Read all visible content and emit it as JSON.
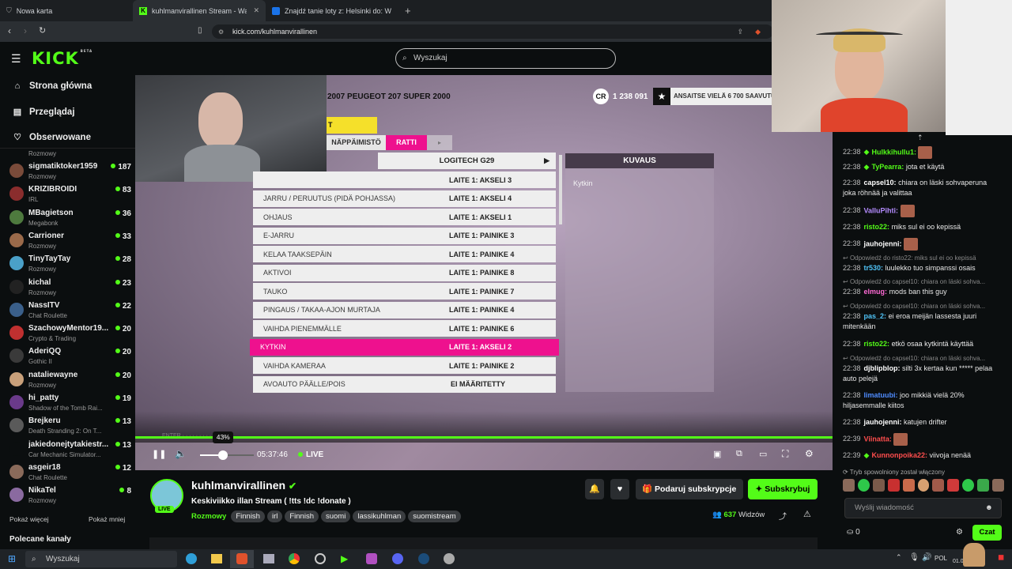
{
  "browser": {
    "tabs": [
      {
        "label": "Nowa karta"
      },
      {
        "label": "kuhlmanvirallinen Stream - Watc"
      },
      {
        "label": "Znajdź tanie loty z: Helsinki do: Wars"
      }
    ],
    "url": "kick.com/kuhlmanvirallinen"
  },
  "site": {
    "logo": "KICK",
    "logo_badge": "BETA",
    "search_placeholder": "Wyszukaj"
  },
  "sidebar": {
    "nav": [
      {
        "label": "Strona główna",
        "icon": "home-icon"
      },
      {
        "label": "Przeglądaj",
        "icon": "browse-icon"
      },
      {
        "label": "Obserwowane",
        "icon": "heart-icon"
      }
    ],
    "first_category_partial": "Rozmowy",
    "channels": [
      {
        "name": "sigmatiktoker1959",
        "category": "Rozmowy",
        "viewers": "187",
        "color": "#7a4b3a"
      },
      {
        "name": "KRIZIBROIDI",
        "category": "IRL",
        "viewers": "83",
        "color": "#8a2d2d"
      },
      {
        "name": "MBagietson",
        "category": "Megabonk",
        "viewers": "36",
        "color": "#4e7a3e"
      },
      {
        "name": "Carrioner",
        "category": "Rozmowy",
        "viewers": "33",
        "color": "#9a6a4a"
      },
      {
        "name": "TinyTayTay",
        "category": "Rozmowy",
        "viewers": "28",
        "color": "#4aa0c8"
      },
      {
        "name": "kichal",
        "category": "Rozmowy",
        "viewers": "23",
        "color": "#222222"
      },
      {
        "name": "NassITV",
        "category": "Chat Roulette",
        "viewers": "22",
        "color": "#3a5f8a"
      },
      {
        "name": "SzachowyMentor19...",
        "category": "Crypto & Trading",
        "viewers": "20",
        "color": "#c03030"
      },
      {
        "name": "AderiQQ",
        "category": "Gothic II",
        "viewers": "20",
        "color": "#3a3a3a"
      },
      {
        "name": "nataliewayne",
        "category": "Rozmowy",
        "viewers": "20",
        "color": "#c8a07a"
      },
      {
        "name": "hi_patty",
        "category": "Shadow of the Tomb Rai...",
        "viewers": "19",
        "color": "#6a3a8a"
      },
      {
        "name": "Brejkeru",
        "category": "Death Stranding 2: On T...",
        "viewers": "13",
        "color": "#5a5a5a"
      },
      {
        "name": "jakiedonejtytakiestr...",
        "category": "Car Mechanic Simulator...",
        "viewers": "13",
        "color": "#0b0e0f"
      },
      {
        "name": "asgeir18",
        "category": "Chat Roulette",
        "viewers": "12",
        "color": "#8a6a5a"
      },
      {
        "name": "NikaTel",
        "category": "Rozmowy",
        "viewers": "8",
        "color": "#8a6aa0"
      }
    ],
    "show_more": "Pokaż więcej",
    "show_less": "Pokaż mniej",
    "recommended": "Polecane kanały"
  },
  "game": {
    "car_title": "2007 PEUGEOT 207 SUPER 2000",
    "credits": "1 238 091",
    "promo": "ANSAITSE VIELÄ 6 700 SAAVUTUS",
    "tab_keyboard": "NÄPPÄIMISTÖ",
    "tab_wheel": "RATTI",
    "device": "LOGITECH G29",
    "desc_header": "KUVAUS",
    "desc_text": "Kytkin",
    "rows": [
      {
        "label": "",
        "value": "LAITE 1: AKSELI 3"
      },
      {
        "label": "JARRU / PERUUTUS (PIDÄ POHJASSA)",
        "value": "LAITE 1: AKSELI 4"
      },
      {
        "label": "OHJAUS",
        "value": "LAITE 1: AKSELI 1"
      },
      {
        "label": "E-JARRU",
        "value": "LAITE 1: PAINIKE 3"
      },
      {
        "label": "KELAA TAAKSEPÄIN",
        "value": "LAITE 1: PAINIKE 4"
      },
      {
        "label": "AKTIVOI",
        "value": "LAITE 1: PAINIKE 8"
      },
      {
        "label": "TAUKO",
        "value": "LAITE 1: PAINIKE 7"
      },
      {
        "label": "PINGAUS / TAKAA-AJON MURTAJA",
        "value": "LAITE 1: PAINIKE 4"
      },
      {
        "label": "VAIHDA PIENEMMÄLLE",
        "value": "LAITE 1: PAINIKE 6"
      },
      {
        "label": "KYTKIN",
        "value": "LAITE 1: AKSELI 2"
      },
      {
        "label": "VAIHDA KAMERAA",
        "value": "LAITE 1: PAINIKE 2"
      },
      {
        "label": "AVOAUTO PÄÄLLE/POIS",
        "value": "EI MÄÄRITETTY"
      }
    ],
    "selected_row": 9
  },
  "player": {
    "volume_tooltip": "43%",
    "volume": 0.43,
    "time": "05:37:46",
    "live": "LIVE"
  },
  "stream": {
    "channel": "kuhlmanvirallinen",
    "title": "Keskiviikko illan Stream ( !tts !dc !donate )",
    "category": "Rozmowy",
    "tags": [
      "Finnish",
      "irl",
      "Finnish",
      "suomi",
      "lassikuhlman",
      "suomistream"
    ],
    "live_badge": "LIVE",
    "gift_button": "Podaruj subskrypcje",
    "subscribe_button": "Subskrybuj",
    "viewers": "637",
    "viewers_label": "Widzów"
  },
  "chat": {
    "messages": [
      {
        "time": "22:38",
        "user": "Hulkkihullu1:",
        "text": "",
        "color": "#53fc18",
        "badge": true
      },
      {
        "time": "22:38",
        "user": "TyPearra:",
        "text": "jota et käytä",
        "color": "#53fc18",
        "badge": true
      },
      {
        "time": "22:38",
        "user": "capsel10:",
        "text": "chiara on läski sohvaperuna joka röhnää ja valittaa",
        "color": "#ffffff"
      },
      {
        "time": "22:38",
        "user": "ValluPihti:",
        "text": "",
        "color": "#b48cff"
      },
      {
        "time": "22:38",
        "user": "risto22:",
        "text": "miks sul ei oo kepissä",
        "color": "#53fc18"
      },
      {
        "time": "22:38",
        "user": "jauhojenni:",
        "text": "",
        "color": "#ffffff"
      },
      {
        "reply": "Odpowiedź do risto22: miks sul ei oo kepissä",
        "time": "22:38",
        "user": "tr530:",
        "text": "luulekko tuo simpanssi osais",
        "color": "#4fc3f7"
      },
      {
        "reply": "Odpowiedź do capsel10: chiara on läski sohva...",
        "time": "22:38",
        "user": "elmug:",
        "text": "mods ban this guy",
        "color": "#ff6ad5"
      },
      {
        "reply": "Odpowiedź do capsel10: chiara on läski sohva...",
        "time": "22:38",
        "user": "pas_2:",
        "text": "ei eroa meijän lassesta juuri mitenkään",
        "color": "#4fc3f7"
      },
      {
        "time": "22:38",
        "user": "risto22:",
        "text": "etkö osaa kytkintä käyttää",
        "color": "#53fc18"
      },
      {
        "reply": "Odpowiedź do capsel10: chiara on läski sohva...",
        "time": "22:38",
        "user": "djblipblop:",
        "text": "silti 3x kertaa kun ***** pelaa auto pelejä",
        "color": "#ffffff"
      },
      {
        "time": "22:38",
        "user": "limatuubi:",
        "text": "joo mikkiä vielä 20% hiljasemmalle kiitos",
        "color": "#4f8cff"
      },
      {
        "time": "22:38",
        "user": "jauhojenni:",
        "text": "katujen drifter",
        "color": "#ffffff"
      },
      {
        "time": "22:39",
        "user": "Viinatta:",
        "text": "",
        "color": "#ff4d4d"
      },
      {
        "time": "22:39",
        "user": "Kunnonpoika22:",
        "text": "viivoja nenää",
        "color": "#ff4d4d",
        "badge": true
      }
    ],
    "slow_mode": "Tryb spowolniony został włączony",
    "input_placeholder": "Wyślij wiadomość",
    "points": "0",
    "send_button": "Czat"
  },
  "taskbar": {
    "search": "Wyszukaj",
    "lang": "POL",
    "date": "01.0"
  }
}
